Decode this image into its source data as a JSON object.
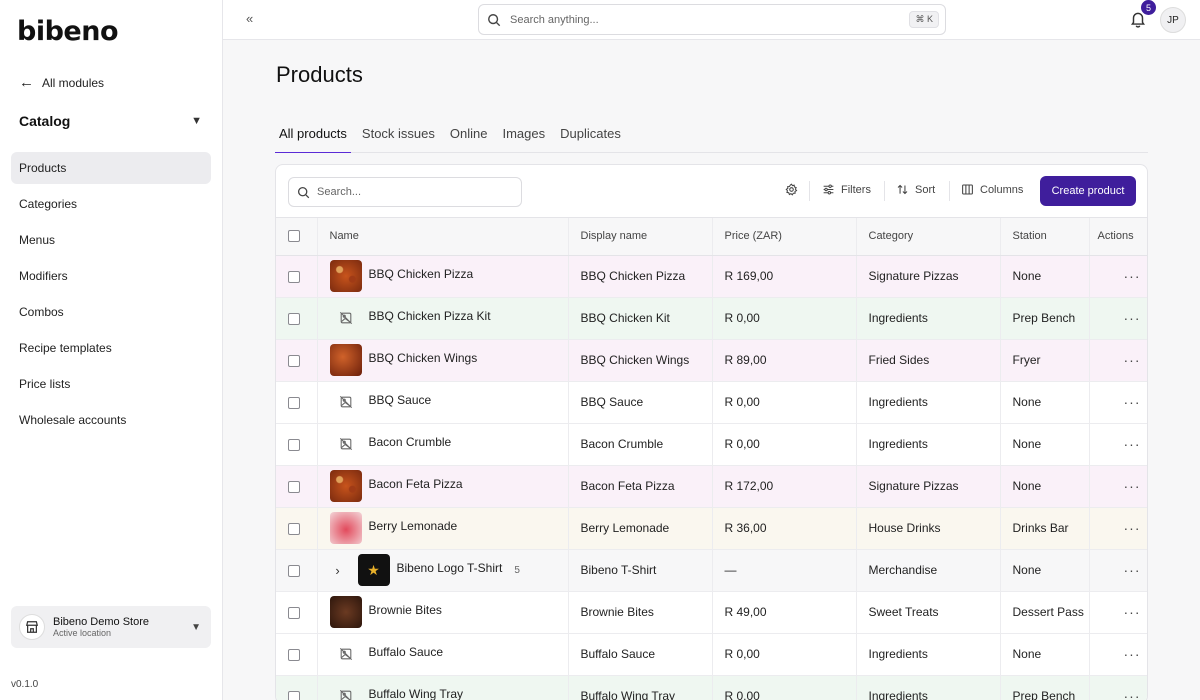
{
  "brand": {
    "logo_text": "bibeno"
  },
  "sidebar": {
    "back_label": "All modules",
    "section_label": "Catalog",
    "items": [
      {
        "label": "Products",
        "active": true
      },
      {
        "label": "Categories"
      },
      {
        "label": "Menus"
      },
      {
        "label": "Modifiers"
      },
      {
        "label": "Combos"
      },
      {
        "label": "Recipe templates"
      },
      {
        "label": "Price lists"
      },
      {
        "label": "Wholesale accounts"
      }
    ],
    "store": {
      "name": "Bibeno Demo Store",
      "subtitle": "Active location"
    },
    "version": "v0.1.0"
  },
  "topbar": {
    "search_placeholder": "Search anything...",
    "shortcut": "⌘ K",
    "notification_count": "5",
    "avatar_initials": "JP"
  },
  "page": {
    "title": "Products",
    "tabs": [
      {
        "label": "All products",
        "active": true
      },
      {
        "label": "Stock issues"
      },
      {
        "label": "Online"
      },
      {
        "label": "Images"
      },
      {
        "label": "Duplicates"
      }
    ]
  },
  "toolbar": {
    "search_placeholder": "Search...",
    "filters_label": "Filters",
    "sort_label": "Sort",
    "columns_label": "Columns",
    "create_label": "Create product"
  },
  "table": {
    "columns": [
      "Name",
      "Display name",
      "Price (ZAR)",
      "Category",
      "Station",
      "Actions"
    ],
    "rows": [
      {
        "name": "BBQ Chicken Pizza",
        "display": "BBQ Chicken Pizza",
        "price": "R 169,00",
        "category": "Signature Pizzas",
        "station": "None",
        "tint": "pink",
        "image": "pizza"
      },
      {
        "name": "BBQ Chicken Pizza Kit",
        "display": "BBQ Chicken Kit",
        "price": "R 0,00",
        "category": "Ingredients",
        "station": "Prep Bench",
        "tint": "green",
        "image": "none"
      },
      {
        "name": "BBQ Chicken Wings",
        "display": "BBQ Chicken Wings",
        "price": "R 89,00",
        "category": "Fried Sides",
        "station": "Fryer",
        "tint": "pink",
        "image": "wings"
      },
      {
        "name": "BBQ Sauce",
        "display": "BBQ Sauce",
        "price": "R 0,00",
        "category": "Ingredients",
        "station": "None",
        "tint": "",
        "image": "none"
      },
      {
        "name": "Bacon Crumble",
        "display": "Bacon Crumble",
        "price": "R 0,00",
        "category": "Ingredients",
        "station": "None",
        "tint": "",
        "image": "none"
      },
      {
        "name": "Bacon Feta Pizza",
        "display": "Bacon Feta Pizza",
        "price": "R 172,00",
        "category": "Signature Pizzas",
        "station": "None",
        "tint": "pink",
        "image": "pizza"
      },
      {
        "name": "Berry Lemonade",
        "display": "Berry Lemonade",
        "price": "R 36,00",
        "category": "House Drinks",
        "station": "Drinks Bar",
        "tint": "cream",
        "image": "lemon"
      },
      {
        "name": "Bibeno Logo T-Shirt",
        "display": "Bibeno T-Shirt",
        "price": "—",
        "category": "Merchandise",
        "station": "None",
        "tint": "grey",
        "image": "tee",
        "variants": "5"
      },
      {
        "name": "Brownie Bites",
        "display": "Brownie Bites",
        "price": "R 49,00",
        "category": "Sweet Treats",
        "station": "Dessert Pass",
        "tint": "",
        "image": "brownie"
      },
      {
        "name": "Buffalo Sauce",
        "display": "Buffalo Sauce",
        "price": "R 0,00",
        "category": "Ingredients",
        "station": "None",
        "tint": "",
        "image": "none"
      },
      {
        "name": "Buffalo Wing Tray",
        "display": "Buffalo Wing Tray",
        "price": "R 0,00",
        "category": "Ingredients",
        "station": "Prep Bench",
        "tint": "green",
        "image": "none"
      }
    ]
  }
}
